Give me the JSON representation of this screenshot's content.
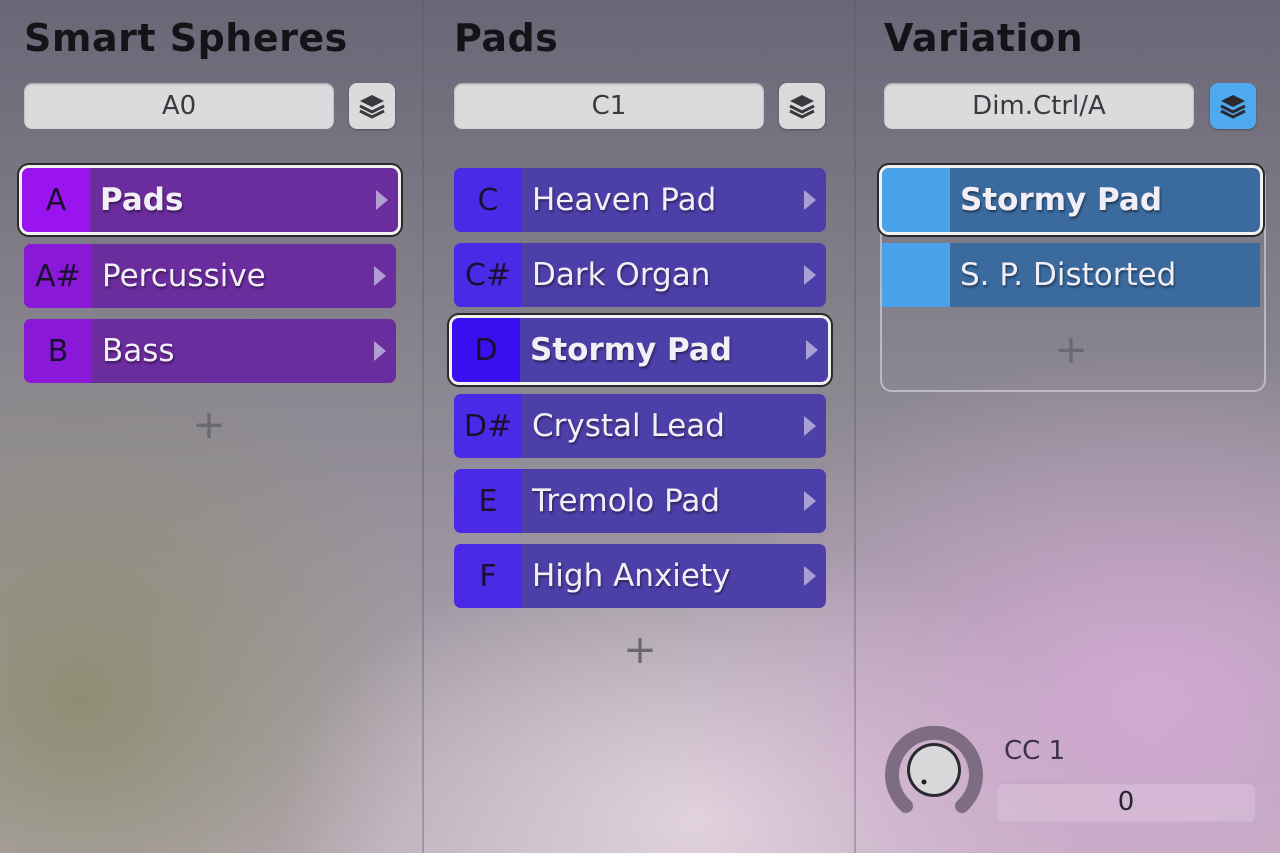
{
  "columns": [
    {
      "title": "Smart Spheres",
      "selector": "A0",
      "layer_active": false,
      "items": [
        {
          "key": "A",
          "label": "Pads",
          "selected": true
        },
        {
          "key": "A#",
          "label": "Percussive",
          "selected": false
        },
        {
          "key": "B",
          "label": "Bass",
          "selected": false
        }
      ],
      "add_label": "+"
    },
    {
      "title": "Pads",
      "selector": "C1",
      "layer_active": false,
      "items": [
        {
          "key": "C",
          "label": "Heaven Pad",
          "selected": false
        },
        {
          "key": "C#",
          "label": "Dark Organ",
          "selected": false
        },
        {
          "key": "D",
          "label": "Stormy Pad",
          "selected": true
        },
        {
          "key": "D#",
          "label": "Crystal Lead",
          "selected": false
        },
        {
          "key": "E",
          "label": "Tremolo Pad",
          "selected": false
        },
        {
          "key": "F",
          "label": "High Anxiety",
          "selected": false
        }
      ],
      "add_label": "+"
    },
    {
      "title": "Variation",
      "selector": "Dim.Ctrl/A",
      "layer_active": true,
      "items": [
        {
          "key": "",
          "label": "Stormy Pad",
          "selected": true
        },
        {
          "key": "",
          "label": "S. P. Distorted",
          "selected": false
        }
      ],
      "add_label": "+"
    }
  ],
  "controller": {
    "label": "CC 1",
    "value": "0"
  },
  "colors": {
    "purple": "#6b2c9e",
    "indigo": "#4d3fa8",
    "blue": "#3a6a9e",
    "layer_active": "#4fa9ee"
  }
}
